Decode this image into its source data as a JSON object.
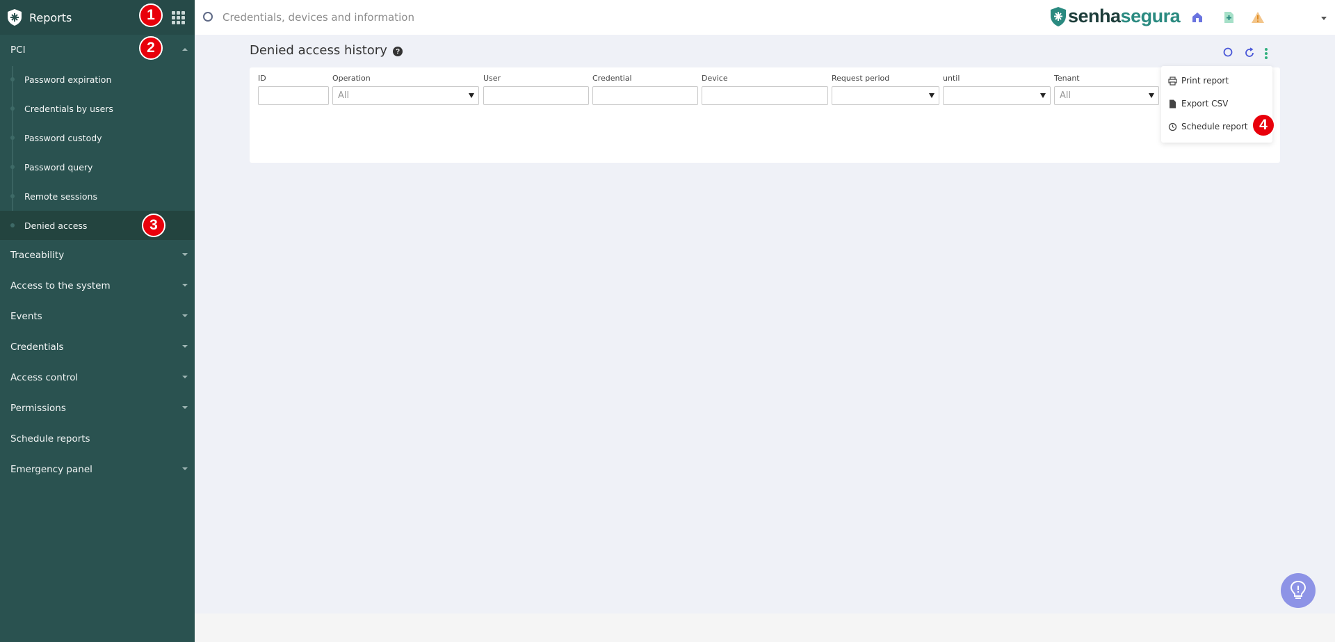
{
  "sidebar": {
    "title": "Reports",
    "sections": [
      {
        "label": "PCI"
      },
      {
        "label": "Traceability"
      },
      {
        "label": "Access to the system"
      },
      {
        "label": "Events"
      },
      {
        "label": "Credentials"
      },
      {
        "label": "Access control"
      },
      {
        "label": "Permissions"
      },
      {
        "label": "Schedule reports"
      },
      {
        "label": "Emergency panel"
      }
    ],
    "pci_items": [
      {
        "label": "Password expiration"
      },
      {
        "label": "Credentials by users"
      },
      {
        "label": "Password custody"
      },
      {
        "label": "Password query"
      },
      {
        "label": "Remote sessions"
      },
      {
        "label": "Denied access"
      }
    ]
  },
  "badges": [
    "1",
    "2",
    "3",
    "4"
  ],
  "topbar": {
    "search_placeholder": "Credentials, devices and information",
    "brand_part1": "senha",
    "brand_part2": "segura"
  },
  "main": {
    "title": "Denied access history",
    "help_icon": "?",
    "filters": {
      "id_label": "ID",
      "operation_label": "Operation",
      "operation_value": "All",
      "user_label": "User",
      "credential_label": "Credential",
      "device_label": "Device",
      "request_period_label": "Request period",
      "until_label": "until",
      "tenant_label": "Tenant",
      "tenant_value": "All"
    }
  },
  "menu": {
    "print": "Print report",
    "export": "Export CSV",
    "schedule": "Schedule report"
  },
  "colors": {
    "sidebar_bg": "#2a5250",
    "accent": "#2a8a80",
    "badge": "#e8000b",
    "bulb": "#8d93e6"
  }
}
